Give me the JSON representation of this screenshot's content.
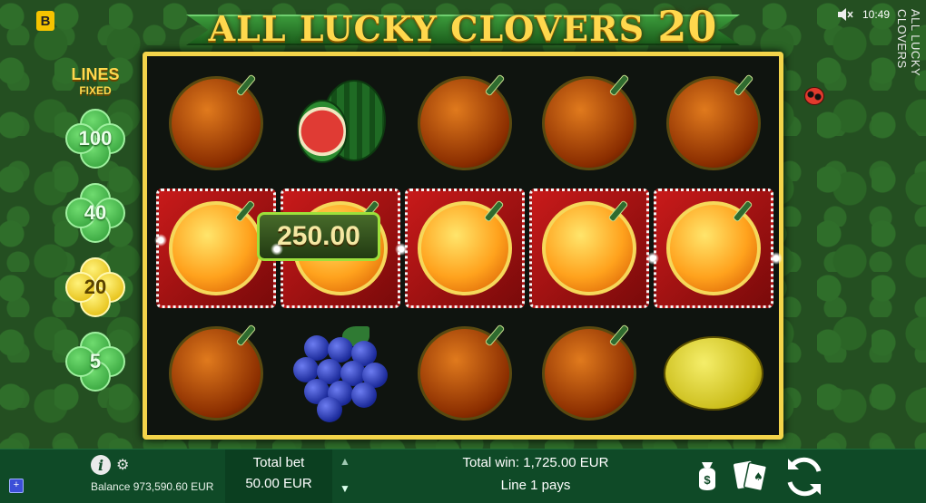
{
  "brand_badge": "B",
  "title": {
    "main": "ALL LUCKY CLOVERS",
    "number": "20"
  },
  "status": {
    "time": "10:49",
    "sound_icon": "sound-muted-icon"
  },
  "vertical_title": "ALL LUCKY CLOVERS",
  "lines_panel": {
    "label": "LINES",
    "sublabel": "FIXED",
    "options": [
      {
        "value": "100",
        "active": false
      },
      {
        "value": "40",
        "active": false
      },
      {
        "value": "20",
        "active": true
      },
      {
        "value": "5",
        "active": false
      }
    ]
  },
  "reels": [
    [
      "orange",
      "orange",
      "orange"
    ],
    [
      "watermelon",
      "orange",
      "grapes"
    ],
    [
      "orange",
      "orange",
      "orange"
    ],
    [
      "orange",
      "orange",
      "orange"
    ],
    [
      "orange",
      "orange",
      "lemon"
    ]
  ],
  "winning_row": 1,
  "win_amount": "250.00",
  "bottom_bar": {
    "balance_label": "Balance",
    "balance_value": "973,590.60 EUR",
    "total_bet_label": "Total bet",
    "total_bet_value": "50.00 EUR",
    "total_win_label": "Total win:",
    "total_win_value": "1,725.00 EUR",
    "line_pays": "Line 1 pays",
    "info_icon_glyph": "i",
    "square_icon_glyph": "+"
  },
  "colors": {
    "frame_gold": "#f3d44a",
    "win_red": "#c81a1a",
    "bar_green": "#0f4a27",
    "win_box_border": "#9de03b"
  }
}
